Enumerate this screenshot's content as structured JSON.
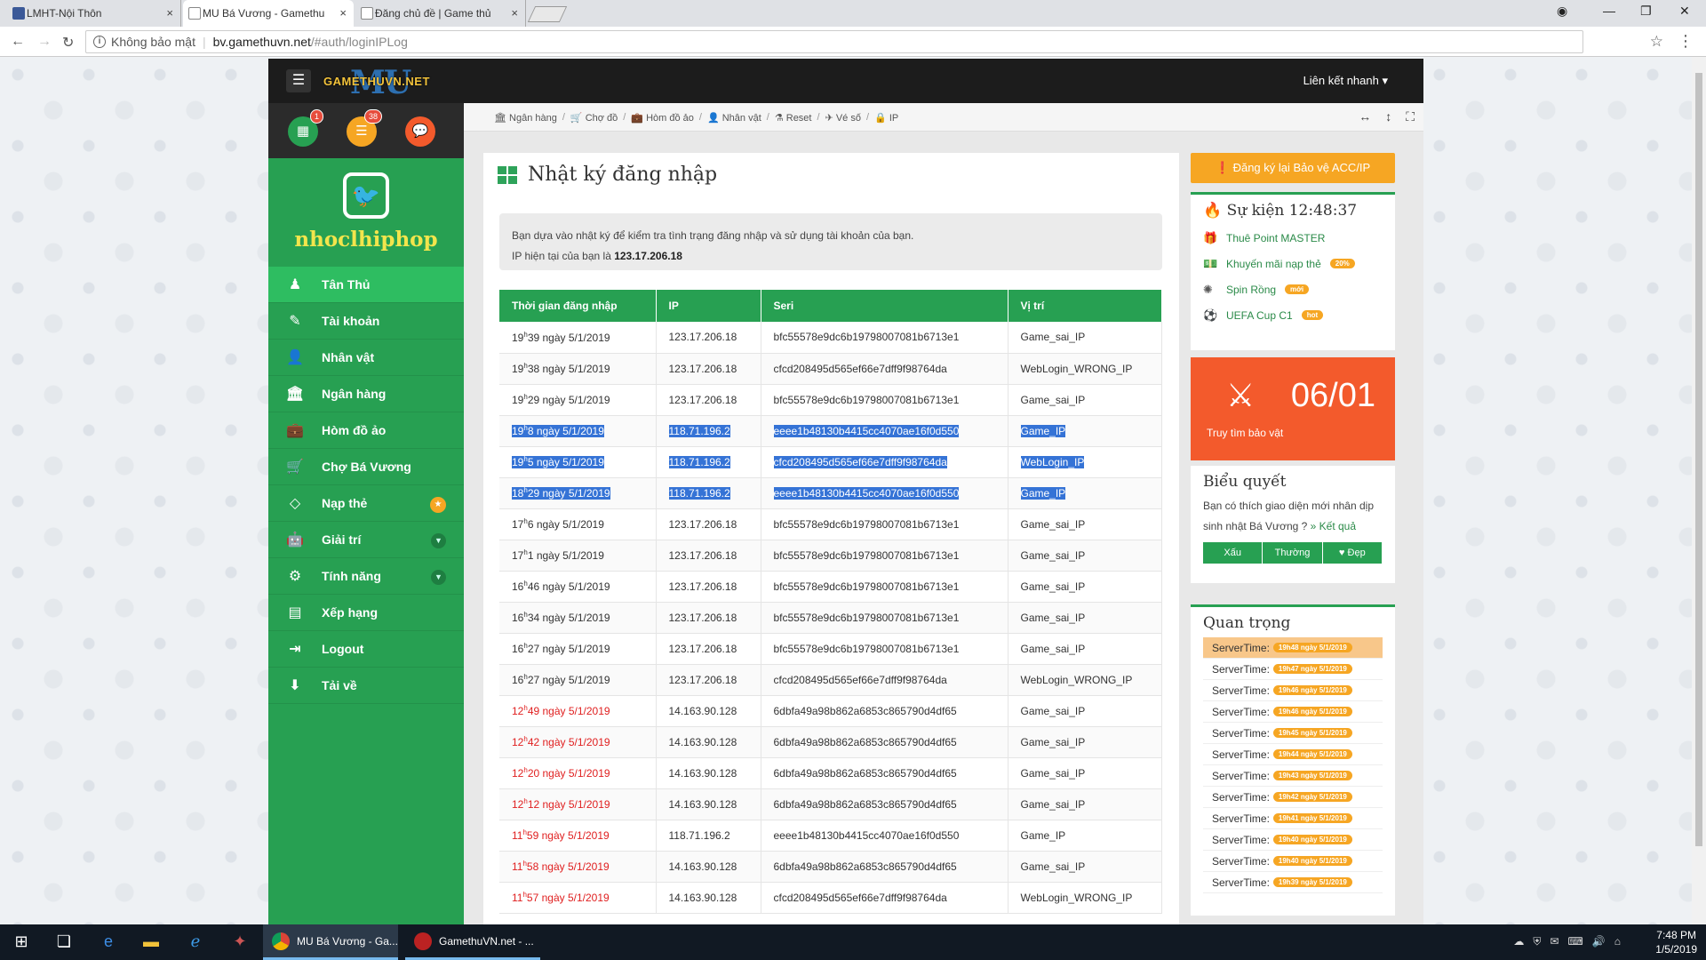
{
  "browser": {
    "tabs": [
      {
        "title": "LMHT-Nội Thôn",
        "close": "×"
      },
      {
        "title": "MU Bá Vương - Gamethu",
        "close": "×"
      },
      {
        "title": "Đăng chủ đề | Game thủ",
        "close": "×"
      }
    ],
    "security": "Không bảo mật",
    "url_host": "bv.gamethuvn.net",
    "url_path": "/#auth/loginIPLog"
  },
  "header": {
    "logo_text": "GAMETHUVN.NET",
    "logo_mu": "MU",
    "quick_links": "Liên kết nhanh ▾"
  },
  "sidebar": {
    "badges": {
      "calendar": "1",
      "list": "38"
    },
    "username": "nhoclhiphop",
    "items": [
      {
        "label": "Tân Thủ",
        "icon": "user-icon"
      },
      {
        "label": "Tài khoản",
        "icon": "edit-icon"
      },
      {
        "label": "Nhân vật",
        "icon": "person-icon"
      },
      {
        "label": "Ngân hàng",
        "icon": "bank-icon"
      },
      {
        "label": "Hòm đồ ảo",
        "icon": "briefcase-icon"
      },
      {
        "label": "Chợ Bá Vương",
        "icon": "cart-icon"
      },
      {
        "label": "Nạp thẻ",
        "icon": "diamond-icon"
      },
      {
        "label": "Giải trí",
        "icon": "android-icon"
      },
      {
        "label": "Tính năng",
        "icon": "gears-icon"
      },
      {
        "label": "Xếp hạng",
        "icon": "bar-chart-icon"
      },
      {
        "label": "Logout",
        "icon": "sign-out-icon"
      },
      {
        "label": "Tải về",
        "icon": "download-icon"
      }
    ]
  },
  "breadcrumb": [
    "Ngân hàng",
    "Chợ đồ",
    "Hòm đồ ảo",
    "Nhân vật",
    "Reset",
    "Vé số",
    "IP"
  ],
  "page": {
    "title": "Nhật ký đăng nhập",
    "notice_line1": "Bạn dựa vào nhật ký để kiểm tra tình trạng đăng nhập và sử dụng tài khoản của bạn.",
    "notice_ip_label": "IP hiện tại của bạn là ",
    "notice_ip": "123.17.206.18"
  },
  "table": {
    "headers": [
      "Thời gian đăng nhập",
      "IP",
      "Seri",
      "Vị trí"
    ],
    "rows": [
      {
        "h": "19",
        "m": "39",
        "date": " ngày 5/1/2019",
        "ip": "123.17.206.18",
        "seri": "bfc55578e9dc6b19798007081b6713e1",
        "pos": "Game_sai_IP"
      },
      {
        "h": "19",
        "m": "38",
        "date": " ngày 5/1/2019",
        "ip": "123.17.206.18",
        "seri": "cfcd208495d565ef66e7dff9f98764da",
        "pos": "WebLogin_WRONG_IP"
      },
      {
        "h": "19",
        "m": "29",
        "date": " ngày 5/1/2019",
        "ip": "123.17.206.18",
        "seri": "bfc55578e9dc6b19798007081b6713e1",
        "pos": "Game_sai_IP"
      },
      {
        "h": "19",
        "m": "8",
        "date": " ngày 5/1/2019",
        "ip": "118.71.196.2",
        "seri": "eeee1b48130b4415cc4070ae16f0d550",
        "pos": "Game_IP",
        "sel": true
      },
      {
        "h": "19",
        "m": "5",
        "date": " ngày 5/1/2019",
        "ip": "118.71.196.2",
        "seri": "cfcd208495d565ef66e7dff9f98764da",
        "pos": "WebLogin_IP",
        "sel": true
      },
      {
        "h": "18",
        "m": "29",
        "date": " ngày 5/1/2019",
        "ip": "118.71.196.2",
        "seri": "eeee1b48130b4415cc4070ae16f0d550",
        "pos": "Game_IP",
        "sel": true
      },
      {
        "h": "17",
        "m": "6",
        "date": " ngày 5/1/2019",
        "ip": "123.17.206.18",
        "seri": "bfc55578e9dc6b19798007081b6713e1",
        "pos": "Game_sai_IP"
      },
      {
        "h": "17",
        "m": "1",
        "date": " ngày 5/1/2019",
        "ip": "123.17.206.18",
        "seri": "bfc55578e9dc6b19798007081b6713e1",
        "pos": "Game_sai_IP"
      },
      {
        "h": "16",
        "m": "46",
        "date": " ngày 5/1/2019",
        "ip": "123.17.206.18",
        "seri": "bfc55578e9dc6b19798007081b6713e1",
        "pos": "Game_sai_IP"
      },
      {
        "h": "16",
        "m": "34",
        "date": " ngày 5/1/2019",
        "ip": "123.17.206.18",
        "seri": "bfc55578e9dc6b19798007081b6713e1",
        "pos": "Game_sai_IP"
      },
      {
        "h": "16",
        "m": "27",
        "date": " ngày 5/1/2019",
        "ip": "123.17.206.18",
        "seri": "bfc55578e9dc6b19798007081b6713e1",
        "pos": "Game_sai_IP"
      },
      {
        "h": "16",
        "m": "27",
        "date": " ngày 5/1/2019",
        "ip": "123.17.206.18",
        "seri": "cfcd208495d565ef66e7dff9f98764da",
        "pos": "WebLogin_WRONG_IP"
      },
      {
        "h": "12",
        "m": "49",
        "date": " ngày 5/1/2019",
        "ip": "14.163.90.128",
        "seri": "6dbfa49a98b862a6853c865790d4df65",
        "pos": "Game_sai_IP",
        "red": true
      },
      {
        "h": "12",
        "m": "42",
        "date": " ngày 5/1/2019",
        "ip": "14.163.90.128",
        "seri": "6dbfa49a98b862a6853c865790d4df65",
        "pos": "Game_sai_IP",
        "red": true
      },
      {
        "h": "12",
        "m": "20",
        "date": " ngày 5/1/2019",
        "ip": "14.163.90.128",
        "seri": "6dbfa49a98b862a6853c865790d4df65",
        "pos": "Game_sai_IP",
        "red": true
      },
      {
        "h": "12",
        "m": "12",
        "date": " ngày 5/1/2019",
        "ip": "14.163.90.128",
        "seri": "6dbfa49a98b862a6853c865790d4df65",
        "pos": "Game_sai_IP",
        "red": true
      },
      {
        "h": "11",
        "m": "59",
        "date": " ngày 5/1/2019",
        "ip": "118.71.196.2",
        "seri": "eeee1b48130b4415cc4070ae16f0d550",
        "pos": "Game_IP",
        "red": true
      },
      {
        "h": "11",
        "m": "58",
        "date": " ngày 5/1/2019",
        "ip": "14.163.90.128",
        "seri": "6dbfa49a98b862a6853c865790d4df65",
        "pos": "Game_sai_IP",
        "red": true
      },
      {
        "h": "11",
        "m": "57",
        "date": " ngày 5/1/2019",
        "ip": "14.163.90.128",
        "seri": "cfcd208495d565ef66e7dff9f98764da",
        "pos": "WebLogin_WRONG_IP",
        "red": true
      }
    ]
  },
  "right": {
    "protect_button": "Đăng ký lại Bảo vệ ACC/IP",
    "events_title": "Sự kiện 12:48:37",
    "events": [
      {
        "label": "Thuê Point MASTER",
        "tag": ""
      },
      {
        "label": "Khuyến mãi nạp thẻ",
        "tag": "20%"
      },
      {
        "label": "Spin Rồng",
        "tag": "mới"
      },
      {
        "label": "UEFA Cup C1",
        "tag": "hot"
      }
    ],
    "treasure_date": "06/01",
    "treasure_label": "Truy tìm bảo vật",
    "poll_title": "Biểu quyết",
    "poll_text": "Bạn có thích giao diện mới nhân dịp sinh nhật Bá Vương ? ",
    "poll_link": "» Kết quả",
    "poll_buttons": [
      "Xấu",
      "Thường",
      "♥ Đẹp"
    ],
    "important_title": "Quan trọng",
    "server_label": "ServerTime:",
    "server_times": [
      "19h48 ngày 5/1/2019",
      "19h47 ngày 5/1/2019",
      "19h46 ngày 5/1/2019",
      "19h46 ngày 5/1/2019",
      "19h45 ngày 5/1/2019",
      "19h44 ngày 5/1/2019",
      "19h43 ngày 5/1/2019",
      "19h42 ngày 5/1/2019",
      "19h41 ngày 5/1/2019",
      "19h40 ngày 5/1/2019",
      "19h40 ngày 5/1/2019",
      "19h39 ngày 5/1/2019"
    ]
  },
  "taskbar": {
    "apps": [
      "MU Bá Vương - Ga...",
      "GamethuVN.net - ..."
    ],
    "time": "7:48 PM",
    "date": "1/5/2019"
  }
}
